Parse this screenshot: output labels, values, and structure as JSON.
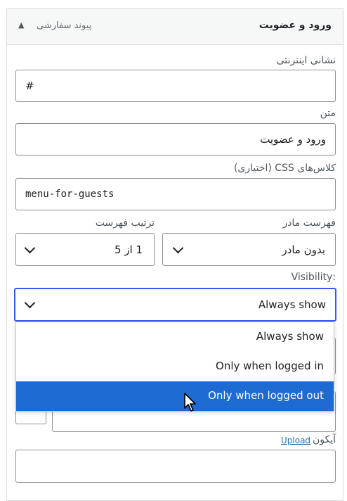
{
  "menu_item": {
    "title": "ورود و عضویت",
    "type_label": "پیوند سفارشی",
    "toggle_icon": "triangle-up-icon"
  },
  "fields": {
    "url": {
      "label": "نشانی اینترنتی",
      "value": "#"
    },
    "text": {
      "label": "متن",
      "value": "ورود و عضویت"
    },
    "css": {
      "label": "کلاس‌های CSS (اختیاری)",
      "value": "menu-for-guests"
    },
    "parent": {
      "label": "فهرست مادر",
      "value": "بدون مادر"
    },
    "order": {
      "label": "ترتیب فهرست",
      "value": "1 از 5"
    },
    "visibility": {
      "label": ":Visibility",
      "value": "Always show",
      "options": [
        "Always show",
        "Only when logged in",
        "Only when logged out"
      ],
      "highlighted": "Only when logged out"
    },
    "icon": {
      "label": "آیکون",
      "upload_label": "Upload"
    }
  },
  "colors": {
    "accent": "#3858e9",
    "highlight": "#1d6bd1",
    "link": "#2271b1"
  }
}
